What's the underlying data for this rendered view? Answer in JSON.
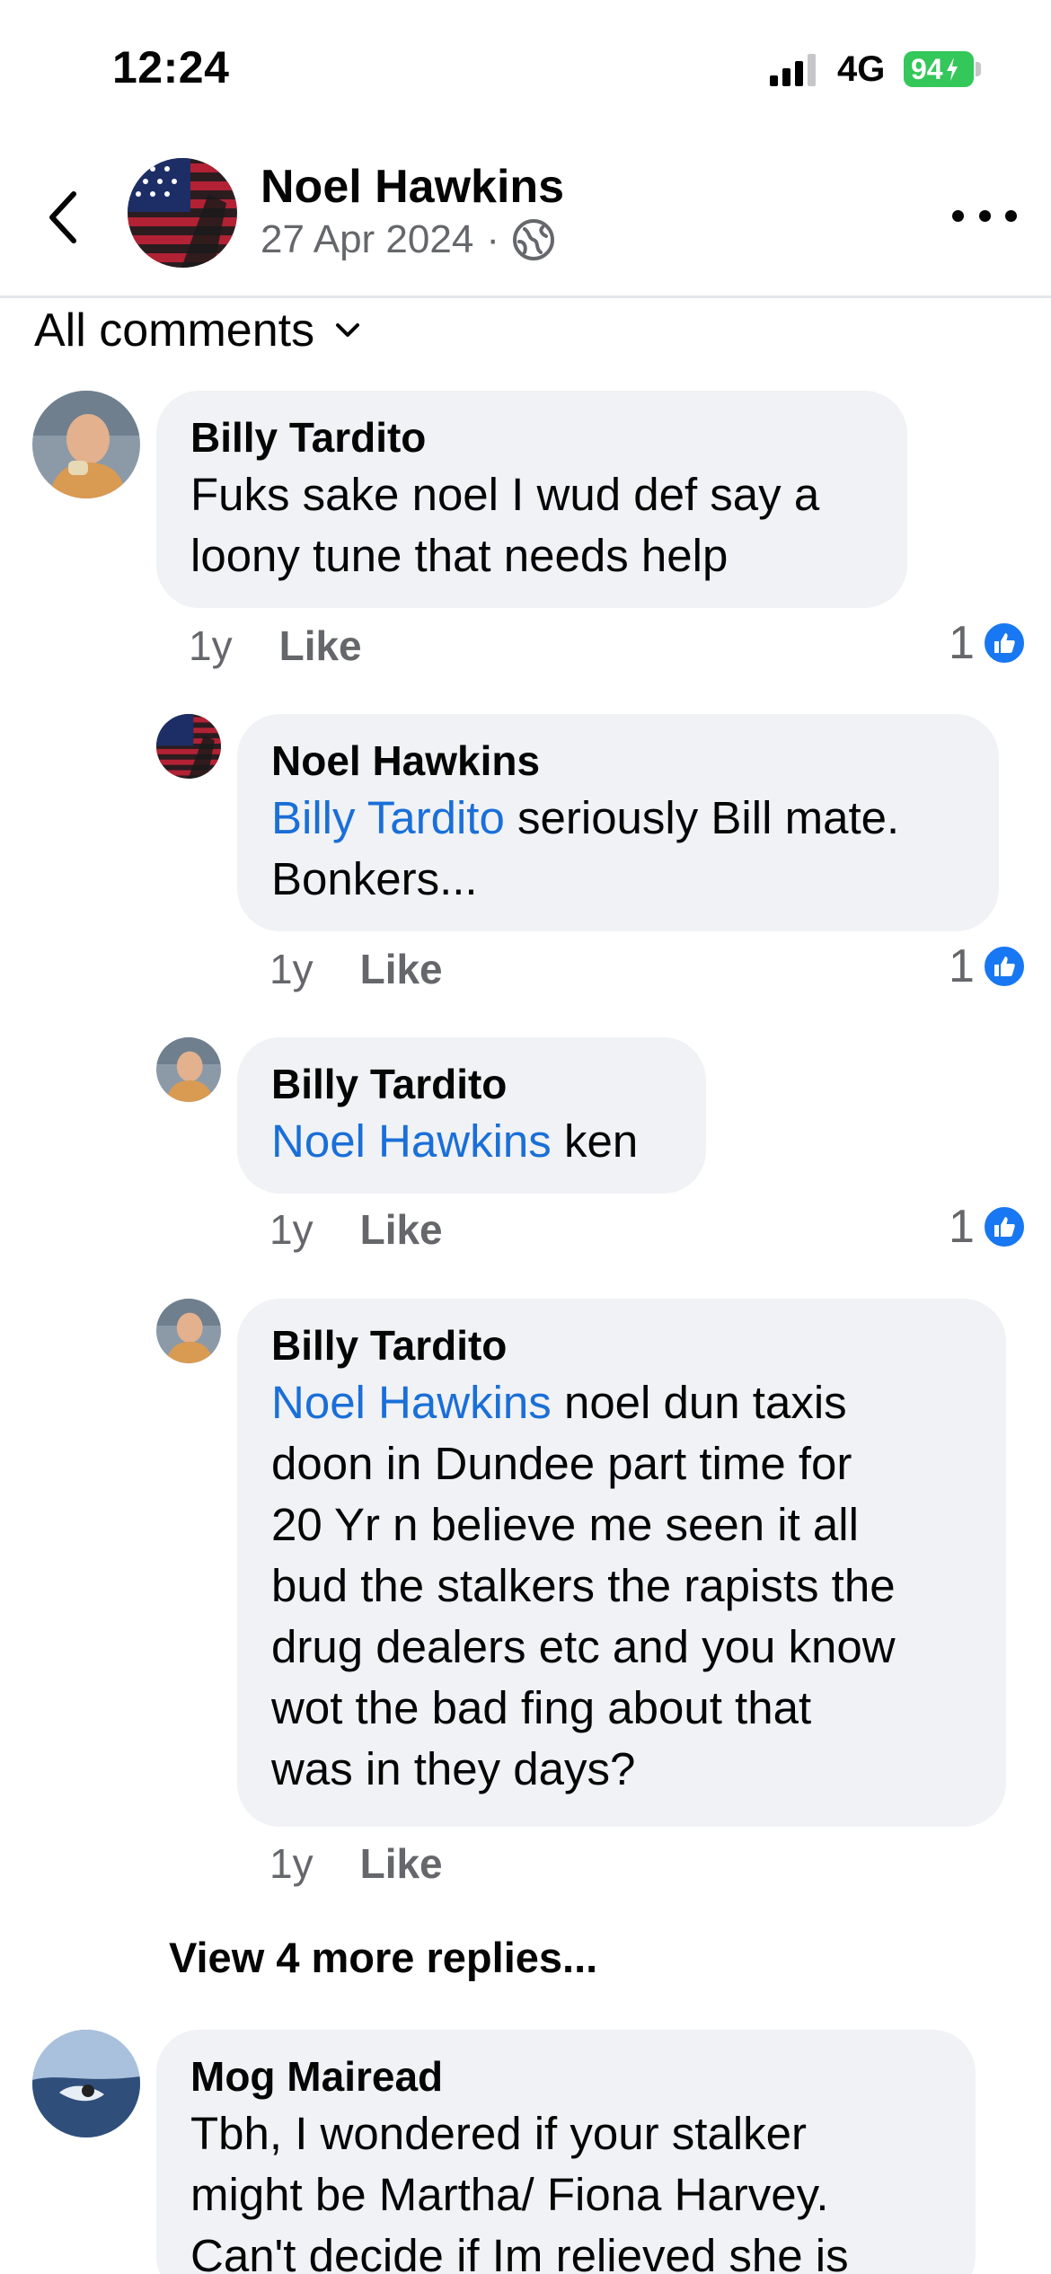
{
  "status_bar": {
    "time": "12:24",
    "network": "4G",
    "battery": "94"
  },
  "header": {
    "name": "Noel Hawkins",
    "date": "27 Apr 2024",
    "separator": "·"
  },
  "filter": {
    "label": "All comments"
  },
  "comments": [
    {
      "author": "Billy Tardito",
      "lines": [
        "Fuks sake noel I wud def say a",
        "loony tune that needs help"
      ],
      "time": "1y",
      "like_label": "Like",
      "reactions": "1"
    },
    {
      "author": "Noel Hawkins",
      "mention": "Billy Tardito",
      "line1_rest": " seriously Bill mate.",
      "line2": "Bonkers...",
      "time": "1y",
      "like_label": "Like",
      "reactions": "1"
    },
    {
      "author": "Billy Tardito",
      "mention": "Noel Hawkins",
      "line1_rest": " ken",
      "time": "1y",
      "like_label": "Like",
      "reactions": "1"
    },
    {
      "author": "Billy Tardito",
      "mention": "Noel Hawkins",
      "line1_rest": " noel dun taxis",
      "lines": [
        "doon in Dundee part time for",
        "20 Yr n believe me seen  it all",
        "bud the stalkers the rapists the",
        "drug dealers etc and you know",
        "wot the bad fing about that",
        "was in they days?"
      ],
      "time": "1y",
      "like_label": "Like"
    },
    {
      "author": "Mog Mairead",
      "lines": [
        "Tbh, I wondered if your stalker",
        "might be Martha/ Fiona Harvey.",
        "Can't decide if Im relieved she is"
      ]
    }
  ],
  "view_more": "View 4 more replies...",
  "colors": {
    "accent": "#1877f2",
    "mention": "#1a6fd8",
    "bubble": "#f0f2f5",
    "battery": "#34c759"
  }
}
